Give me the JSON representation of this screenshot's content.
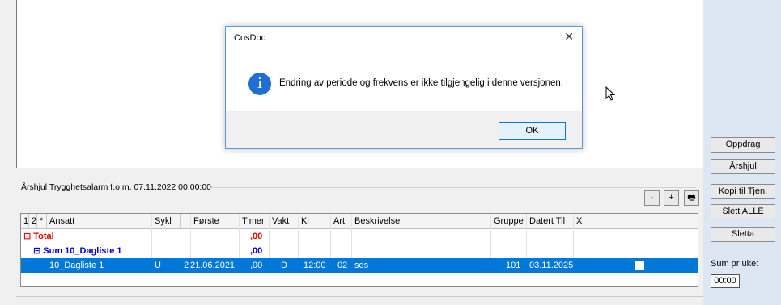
{
  "dialog": {
    "title": "CosDoc",
    "close": "✕",
    "icon_glyph": "i",
    "message": "Endring av periode og frekvens er ikke tilgjengelig i denne versjonen.",
    "ok": "OK"
  },
  "right_panel": {
    "buttons": [
      "Oppdrag",
      "Årshjul",
      "Kopi til Tjen.",
      "Slett ALLE",
      "Sletta"
    ],
    "sum_label": "Sum pr uke:",
    "sum_value": "00:00"
  },
  "group": {
    "title": "Årshjul Trygghetsalarm f.o.m. 07.11.2022 00:00:00",
    "minus": "-",
    "plus": "+",
    "print_icon": "🖶"
  },
  "grid": {
    "headers": [
      "1",
      "2",
      "*",
      "Ansatt",
      "Sykl",
      "",
      "Første",
      "Timer",
      "Vakt",
      "Kl",
      "Art",
      "Beskrivelse",
      "Gruppe",
      "Datert Til",
      "X"
    ],
    "total_row": {
      "label": "⊟ Total",
      "timer": ",00"
    },
    "sum_row": {
      "label": "⊟ Sum 10_Dagliste 1",
      "timer": ",00"
    },
    "data_row": {
      "ansatt": "10_Dagliste 1",
      "sykl": "U",
      "nr": "2",
      "forste": "21.06.2021",
      "timer": ",00",
      "vakt": "D",
      "kl": "12:00",
      "art": "02",
      "beskrivelse": "sds",
      "gruppe": "101",
      "datert_til": "03.11.2025"
    }
  },
  "colors": {
    "accent": "#0078d7",
    "total": "#e00000",
    "sum": "#0000d0",
    "panel": "#dde6f3"
  }
}
